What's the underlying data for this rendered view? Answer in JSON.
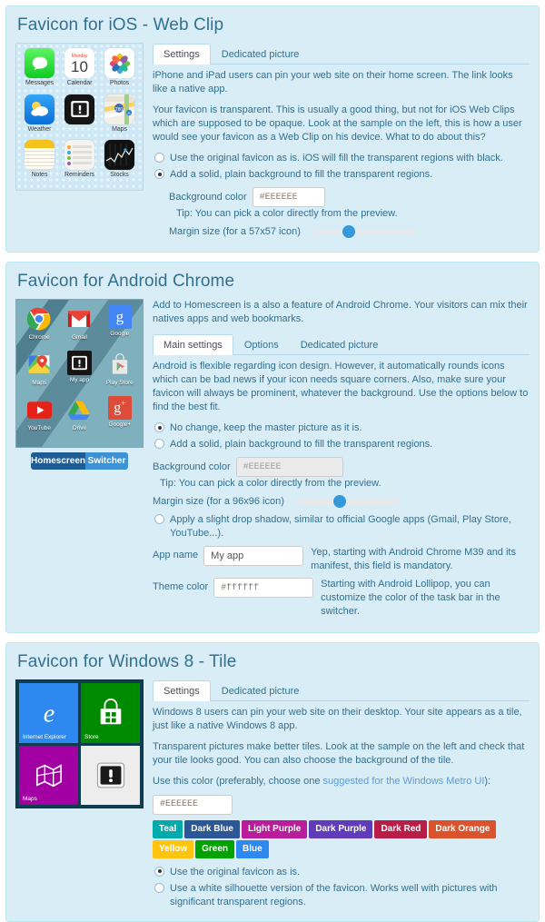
{
  "panels": {
    "ios": {
      "title": "Favicon for iOS - Web Clip",
      "tabs": [
        {
          "label": "Settings",
          "active": true
        },
        {
          "label": "Dedicated picture",
          "active": false
        }
      ],
      "paragraph1": "iPhone and iPad users can pin your web site on their home screen. The link looks like a native app.",
      "paragraph2": "Your favicon is transparent. This is usually a good thing, but not for iOS Web Clips which are supposed to be opaque. Look at the sample on the left, this is how a user would see your favicon as a Web Clip on his device. What to do about this?",
      "radios": [
        {
          "label": "Use the original favicon as is. iOS will fill the transparent regions with black.",
          "checked": false
        },
        {
          "label": "Add a solid, plain background to fill the transparent regions.",
          "checked": true
        }
      ],
      "background_color_label": "Background color",
      "background_color_value": "#EEEEEE",
      "background_color_tip": "Tip: You can pick a color directly from the preview.",
      "margin_label": "Margin size (for a 57x57 icon)",
      "margin_percent": 35,
      "preview_apps": [
        {
          "name": "Messages",
          "icon": "messages-icon"
        },
        {
          "name": "Calendar",
          "icon": "calendar-icon"
        },
        {
          "name": "Photos",
          "icon": "photos-icon"
        },
        {
          "name": "Weather",
          "icon": "weather-icon"
        },
        {
          "name": "",
          "icon": "favicon-sample-icon"
        },
        {
          "name": "Maps",
          "icon": "maps-icon"
        },
        {
          "name": "Notes",
          "icon": "notes-icon"
        },
        {
          "name": "Reminders",
          "icon": "reminders-icon"
        },
        {
          "name": "Stocks",
          "icon": "stocks-icon"
        }
      ]
    },
    "android": {
      "title": "Favicon for Android Chrome",
      "intro": "Add to Homescreen is a also a feature of Android Chrome. Your visitors can mix their natives apps and web bookmarks.",
      "tabs": [
        {
          "label": "Main settings",
          "active": true
        },
        {
          "label": "Options",
          "active": false
        },
        {
          "label": "Dedicated picture",
          "active": false
        }
      ],
      "paragraph1": "Android is flexible regarding icon design. However, it automatically rounds icons which can be bad news if your icon needs square corners. Also, make sure your favicon will always be prominent, whatever the background. Use the options below to find the best fit.",
      "radios": [
        {
          "label": "No change, keep the master picture as it is.",
          "checked": true
        },
        {
          "label": "Add a solid, plain background to fill the transparent regions.",
          "checked": false
        }
      ],
      "background_color_label": "Background color",
      "background_color_value": "#EEEEEE",
      "background_color_tip": "Tip: You can pick a color directly from the preview.",
      "margin_label": "Margin size (for a 96x96 icon)",
      "margin_percent": 40,
      "shadow_radio": {
        "label": "Apply a slight drop shadow, similar to official Google apps (Gmail, Play Store, YouTube...).",
        "checked": false
      },
      "app_name_label": "App name",
      "app_name_value": "My app",
      "app_name_hint": "Yep, starting with Android Chrome M39 and its manifest, this field is mandatory.",
      "theme_color_label": "Theme color",
      "theme_color_value": "#ffffff",
      "theme_color_hint": "Starting with Android Lollipop, you can customize the color of the task bar in the switcher.",
      "preview_apps": [
        {
          "name": "Chrome",
          "icon": "chrome-icon"
        },
        {
          "name": "Gmail",
          "icon": "gmail-icon"
        },
        {
          "name": "Google",
          "icon": "google-icon"
        },
        {
          "name": "Maps",
          "icon": "google-maps-icon"
        },
        {
          "name": "My app",
          "icon": "favicon-sample-icon"
        },
        {
          "name": "Play Store",
          "icon": "play-store-icon"
        },
        {
          "name": "YouTube",
          "icon": "youtube-icon"
        },
        {
          "name": "Drive",
          "icon": "drive-icon"
        },
        {
          "name": "Google+",
          "icon": "google-plus-icon"
        }
      ],
      "toggle": [
        {
          "label": "Homescreen",
          "active": true
        },
        {
          "label": "Switcher",
          "active": false
        }
      ]
    },
    "windows": {
      "title": "Favicon for Windows 8 - Tile",
      "tabs": [
        {
          "label": "Settings",
          "active": true
        },
        {
          "label": "Dedicated picture",
          "active": false
        }
      ],
      "paragraph1": "Windows 8 users can pin your web site on their desktop. Your site appears as a tile, just like a native Windows 8 app.",
      "paragraph2": "Transparent pictures make better tiles. Look at the sample on the left and check that your tile looks good. You can also choose the background of the tile.",
      "color_intro_prefix": "Use this color (preferably, choose one ",
      "color_intro_link": "suggested for the Windows Metro UI",
      "color_intro_suffix": "):",
      "color_value": "#EEEEEE",
      "metro_colors": [
        {
          "label": "Teal",
          "hex": "#00aba9"
        },
        {
          "label": "Dark Blue",
          "hex": "#2b5797"
        },
        {
          "label": "Light Purple",
          "hex": "#b91d9c"
        },
        {
          "label": "Dark Purple",
          "hex": "#603cba"
        },
        {
          "label": "Dark Red",
          "hex": "#b91d47"
        },
        {
          "label": "Dark Orange",
          "hex": "#da532c"
        },
        {
          "label": "Yellow",
          "hex": "#ffc40d"
        },
        {
          "label": "Green",
          "hex": "#00a300"
        },
        {
          "label": "Blue",
          "hex": "#2d89ef"
        }
      ],
      "radios": [
        {
          "label": "Use the original favicon as is.",
          "checked": true
        },
        {
          "label": "Use a white silhouette version of the favicon. Works well with pictures with significant transparent regions.",
          "checked": false
        }
      ],
      "preview_tiles": [
        {
          "name": "Internet Explorer",
          "icon": "internet-explorer-icon",
          "bg": "#2d89ef"
        },
        {
          "name": "Store",
          "icon": "windows-store-icon",
          "bg": "#008a00"
        },
        {
          "name": "Maps",
          "icon": "windows-maps-icon",
          "bg": "#a200a2"
        },
        {
          "name": "",
          "icon": "favicon-sample-icon",
          "bg": "#ededed"
        }
      ]
    }
  }
}
